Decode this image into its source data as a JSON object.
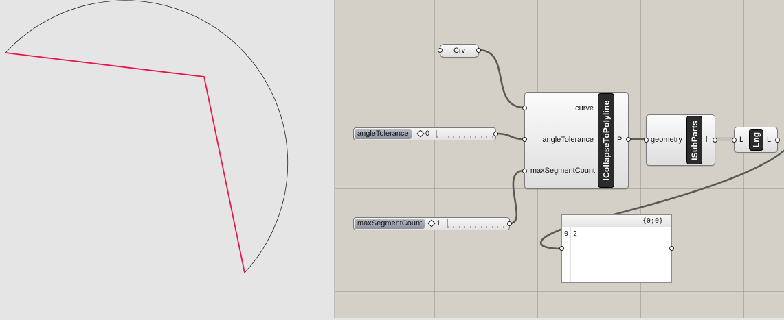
{
  "viewport": {
    "curve_color": "#222222",
    "polyline_color": "#e8174b"
  },
  "components": {
    "crv": {
      "label": "Crv"
    },
    "collapse": {
      "name": "ICollapseToPolyline",
      "inputs": [
        "curve",
        "angleTolerance",
        "maxSegmentCount"
      ],
      "output": "P"
    },
    "subparts": {
      "name": "ISubParts",
      "input": "geometry",
      "output": "l"
    },
    "lng": {
      "name": "Lng",
      "input": "L",
      "output": "L"
    }
  },
  "sliders": [
    {
      "name": "angleTolerance",
      "value": "0"
    },
    {
      "name": "maxSegmentCount",
      "value": "1"
    }
  ],
  "panel": {
    "path": "{0;0}",
    "index": "0",
    "value": "2"
  },
  "colors": {
    "canvas": "#d4d0c8",
    "wire": "#5a5a54",
    "component_bar": "#2b2b2b"
  }
}
